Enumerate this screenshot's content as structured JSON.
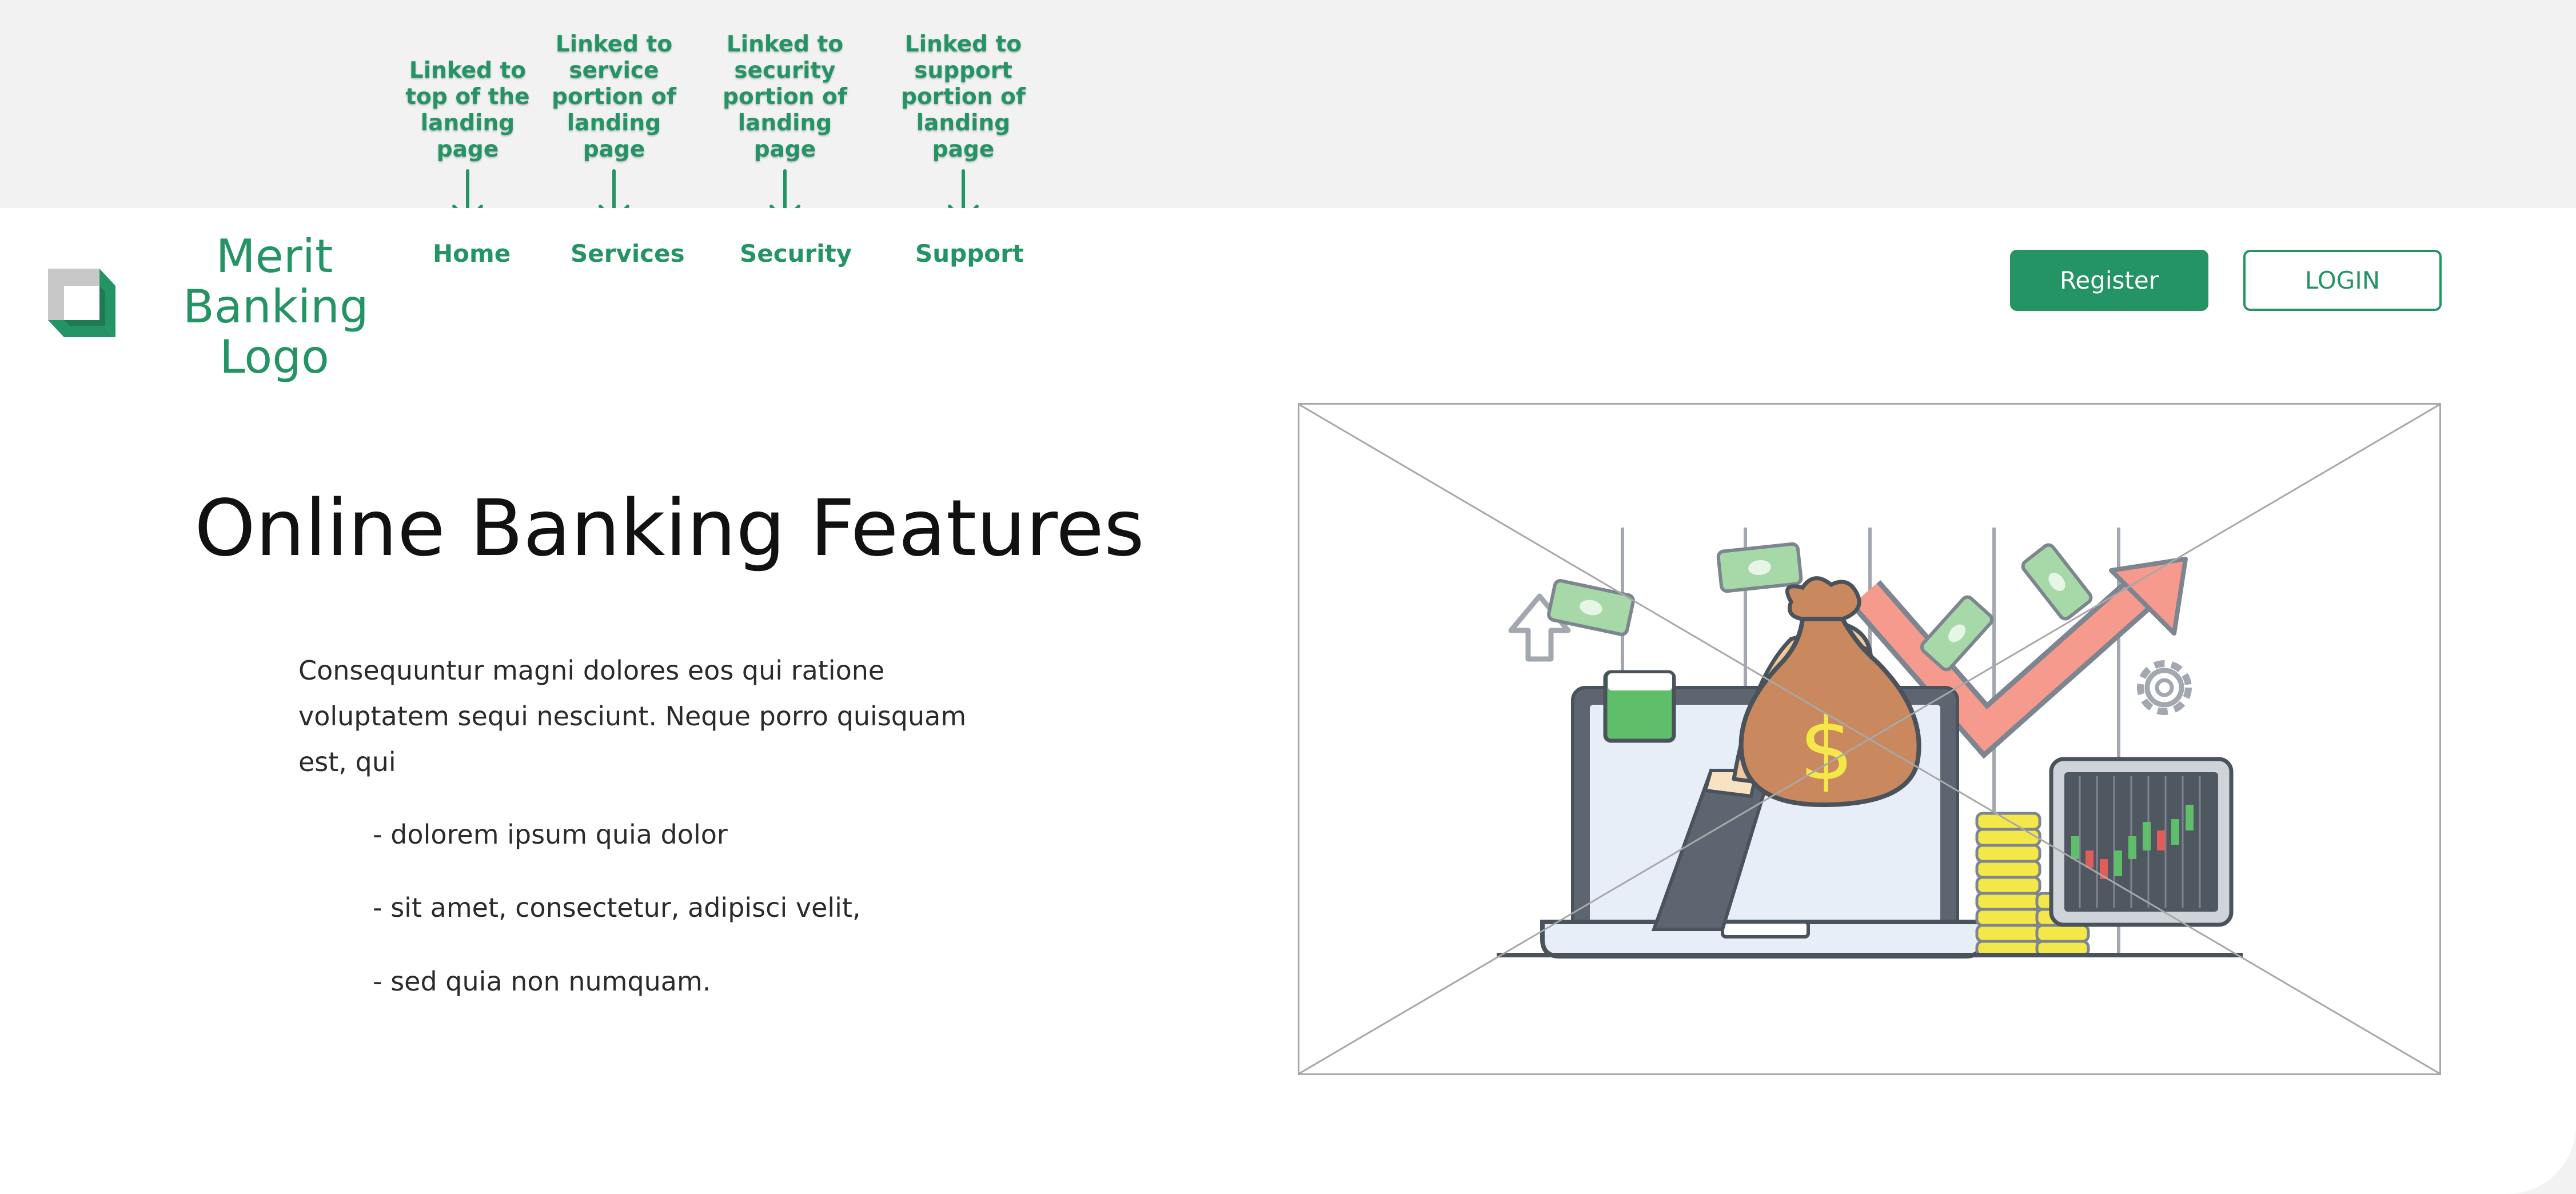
{
  "annotations": [
    {
      "lines": [
        "Linked to",
        "top of the",
        "landing",
        "page"
      ]
    },
    {
      "lines": [
        "Linked to",
        "service",
        "portion of",
        "landing",
        "page"
      ]
    },
    {
      "lines": [
        "Linked to",
        "security",
        "portion of",
        "landing",
        "page"
      ]
    },
    {
      "lines": [
        "Linked to",
        "support",
        "portion of",
        "landing",
        "page"
      ]
    }
  ],
  "logo": {
    "text": "Merit\nBanking\nLogo"
  },
  "nav": {
    "home": "Home",
    "services": "Services",
    "security": "Security",
    "support": "Support"
  },
  "actions": {
    "register": "Register",
    "login": "LOGIN"
  },
  "hero": {
    "title": "Online Banking Features",
    "intro": "Consequuntur magni dolores eos qui ratione voluptatem sequi nesciunt. Neque porro quisquam est, qui",
    "bullets": [
      "- dolorem ipsum quia dolor",
      "- sit amet, consectetur, adipisci velit,",
      "- sed quia non numquam."
    ]
  },
  "colors": {
    "brand": "#259464",
    "background": "#f2f2f2",
    "card": "#ffffff",
    "text": "#111111"
  },
  "illustration": {
    "icons": [
      "money-bag-icon",
      "hand-icon",
      "laptop-icon",
      "trend-arrow-icon",
      "gear-icon",
      "upload-arrow-icon",
      "coin-stack-icon",
      "candlestick-monitor-icon",
      "banknote-icon"
    ]
  }
}
